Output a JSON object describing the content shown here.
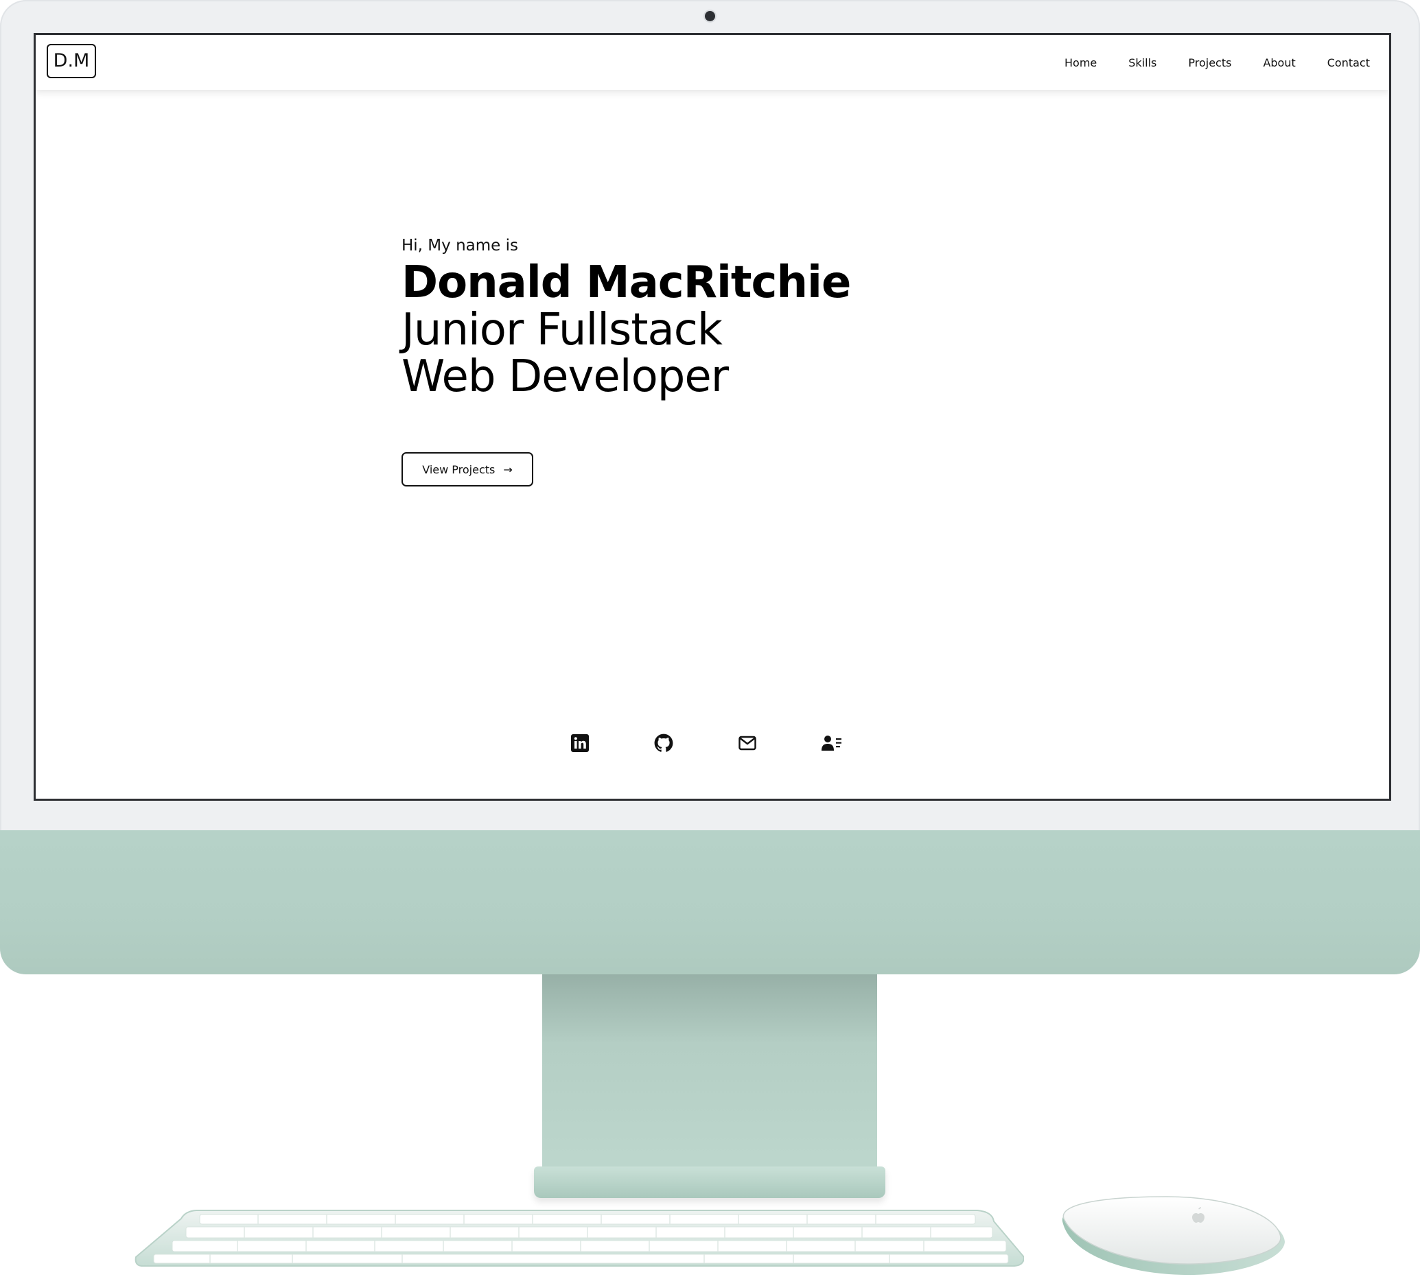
{
  "website": {
    "logo_text": "D.M",
    "nav": {
      "items": [
        {
          "label": "Home"
        },
        {
          "label": "Skills"
        },
        {
          "label": "Projects"
        },
        {
          "label": "About"
        },
        {
          "label": "Contact"
        }
      ]
    },
    "hero": {
      "greeting": "Hi, My name is",
      "name": "Donald MacRitchie",
      "role_line1": "Junior Fullstack",
      "role_line2": "Web Developer",
      "cta_label": "View Projects",
      "cta_arrow": "→"
    },
    "socials": [
      {
        "icon": "linkedin-icon"
      },
      {
        "icon": "github-icon"
      },
      {
        "icon": "mail-icon"
      },
      {
        "icon": "contact-card-icon"
      }
    ]
  },
  "colors": {
    "imac_chin": "#b6d2c8",
    "imac_bezel": "#eef0f2",
    "text": "#111111"
  }
}
